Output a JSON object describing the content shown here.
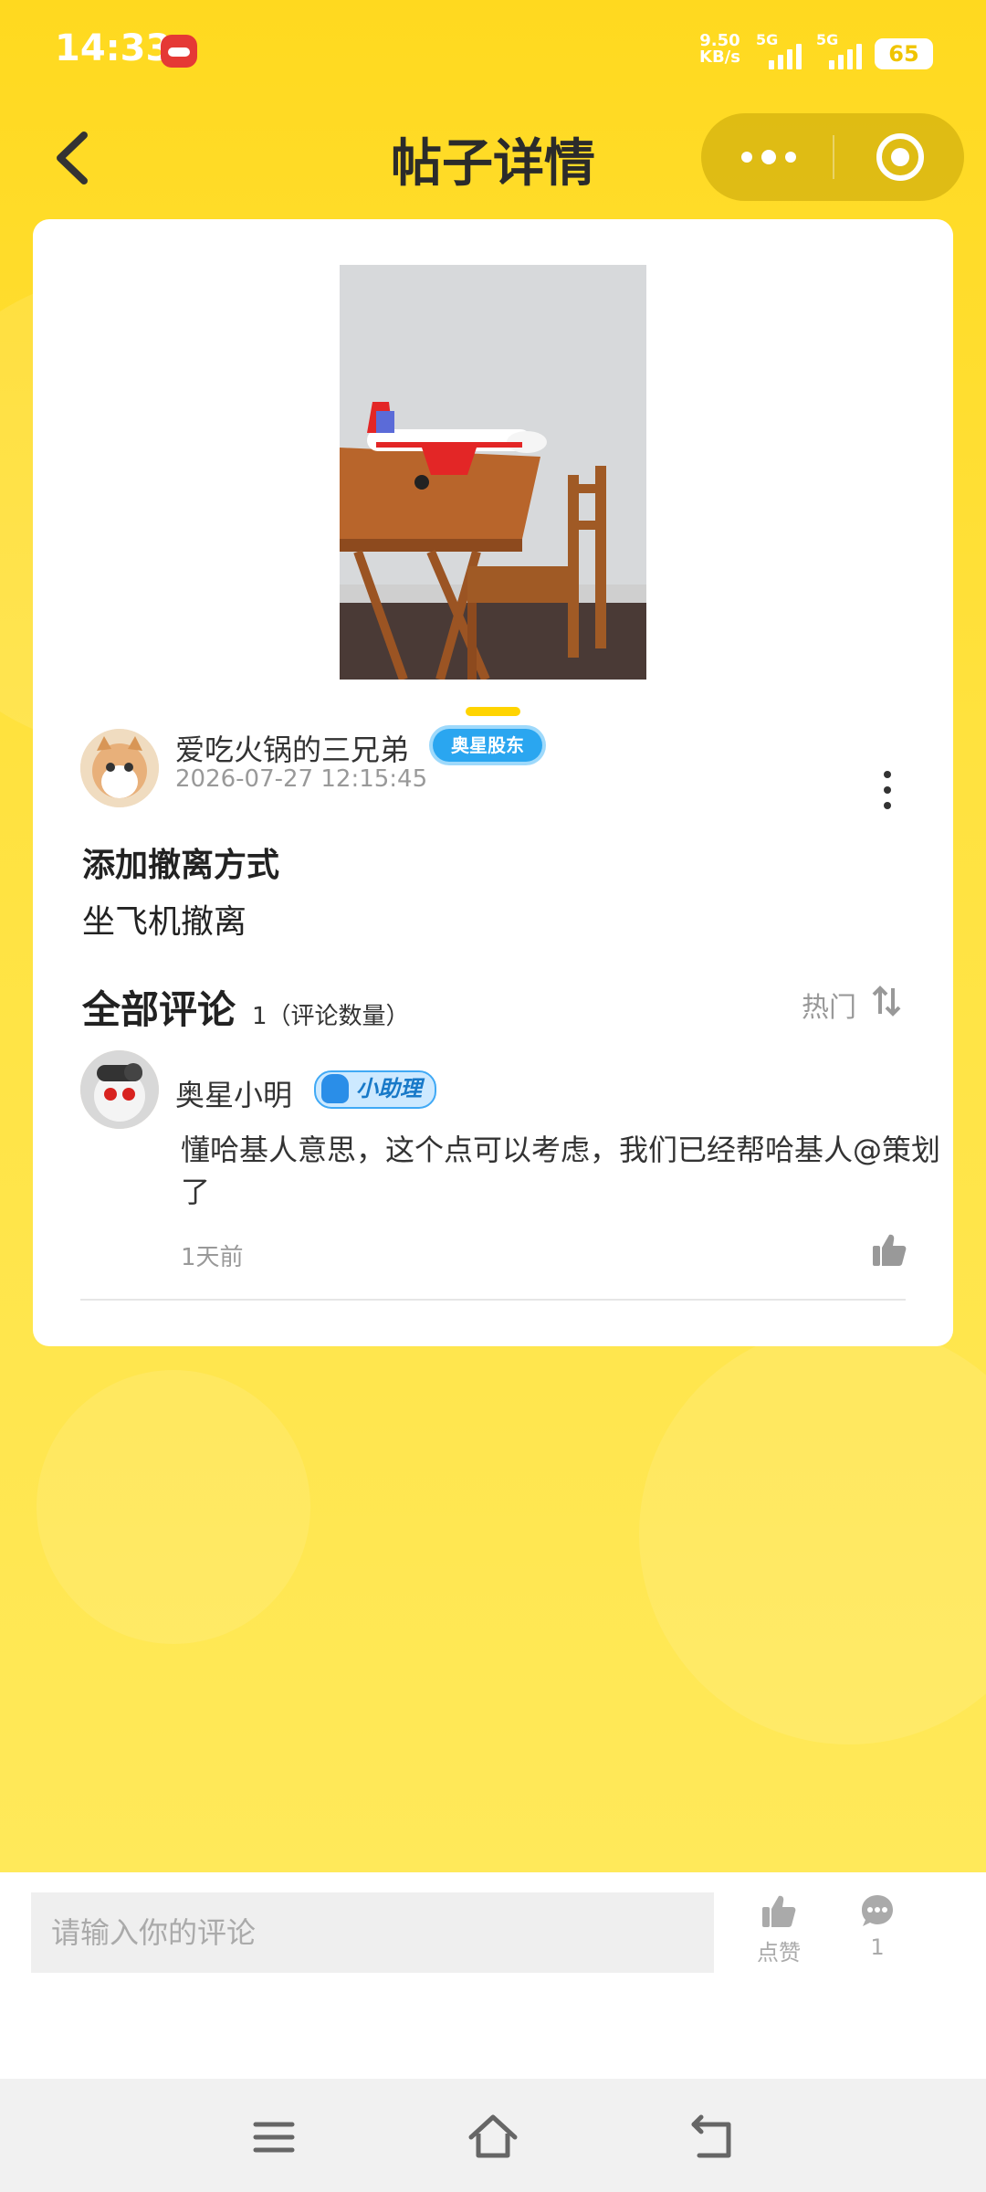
{
  "status_bar": {
    "time": "14:33",
    "net_speed_value": "9.50",
    "net_speed_unit": "KB/s",
    "signal_1": "5G",
    "signal_2": "5G",
    "battery": "65"
  },
  "header": {
    "title": "帖子详情"
  },
  "post": {
    "author_name": "爱吃火锅的三兄弟",
    "author_badge": "奥星股东",
    "time": "2026-07-27 12:15:45",
    "title": "添加撤离方式",
    "body": "坐飞机撤离",
    "image_indicator_count": 1
  },
  "comments_section": {
    "title": "全部评论",
    "count_text": "1（评论数量）",
    "sort_label": "热门"
  },
  "comments": [
    {
      "author_name": "奥星小明",
      "badge": "小助理",
      "text": "懂哈基人意思，这个点可以考虑，我们已经帮哈基人@策划了",
      "time": "1天前"
    }
  ],
  "bottom_bar": {
    "input_placeholder": "请输入你的评论",
    "like_label": "点赞",
    "comment_count": "1"
  },
  "colors": {
    "background": "#ffe03d",
    "accent": "#ffd400",
    "badge_blue": "#2aa6f0"
  },
  "icons": [
    "back-icon",
    "more-dots-icon",
    "close-target-icon",
    "kebab-icon",
    "sort-icon",
    "thumbs-up-icon",
    "comment-bubble-icon",
    "menu-icon",
    "home-icon",
    "back-nav-icon"
  ]
}
